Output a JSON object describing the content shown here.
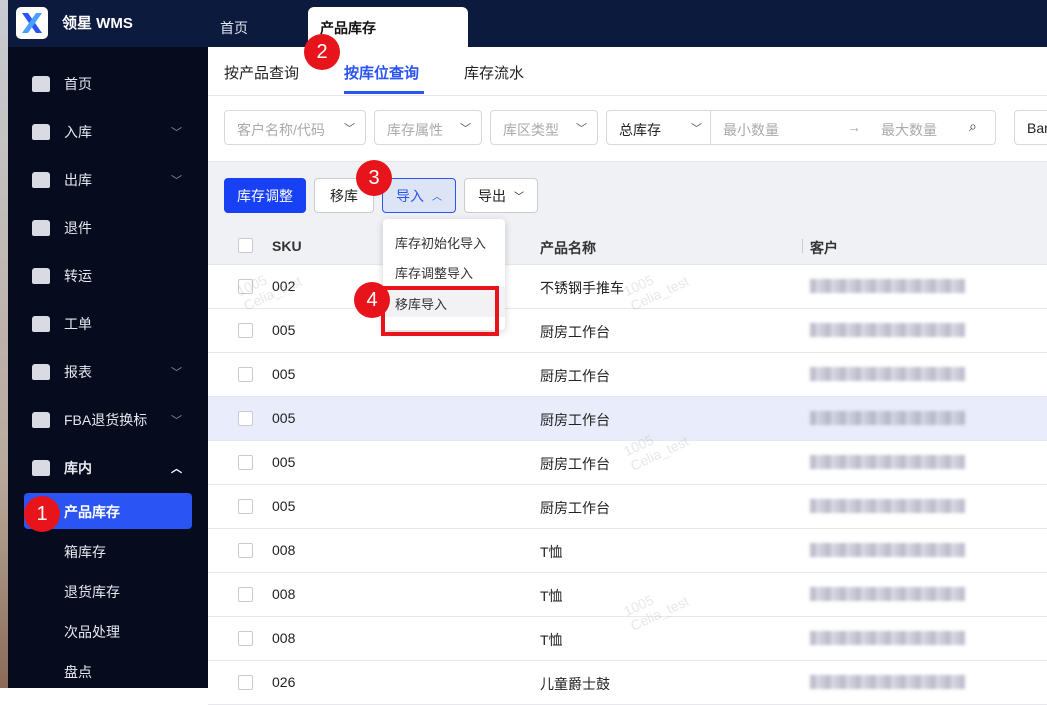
{
  "app": {
    "brand": "领星 WMS"
  },
  "top_tabs": [
    "首页",
    "产品库存"
  ],
  "sidebar": {
    "items": [
      {
        "label": "首页",
        "chevron": false
      },
      {
        "label": "入库",
        "chevron": "down"
      },
      {
        "label": "出库",
        "chevron": "down"
      },
      {
        "label": "退件",
        "chevron": false
      },
      {
        "label": "转运",
        "chevron": false
      },
      {
        "label": "工单",
        "chevron": false
      },
      {
        "label": "报表",
        "chevron": "down"
      },
      {
        "label": "FBA退货换标",
        "chevron": "down"
      },
      {
        "label": "库内",
        "chevron": "up"
      }
    ],
    "sub_items": [
      "产品库存",
      "箱库存",
      "退货库存",
      "次品处理",
      "盘点"
    ]
  },
  "sub_tabs": [
    "按产品查询",
    "按库位查询",
    "库存流水"
  ],
  "filters": {
    "customer": "客户名称/代码",
    "attr": "库存属性",
    "zone": "库区类型",
    "stock_type": "总库存",
    "min": "最小数量",
    "max": "最大数量",
    "extra": "Bar"
  },
  "toolbar": {
    "adjust": "库存调整",
    "move": "移库",
    "import": "导入",
    "export": "导出"
  },
  "import_menu": [
    "库存初始化导入",
    "库存调整导入",
    "移库导入"
  ],
  "table": {
    "headers": [
      "SKU",
      "产品名称",
      "客户"
    ],
    "rows": [
      [
        "002",
        "不锈钢手推车"
      ],
      [
        "005",
        "厨房工作台"
      ],
      [
        "005",
        "厨房工作台"
      ],
      [
        "005",
        "厨房工作台"
      ],
      [
        "005",
        "厨房工作台"
      ],
      [
        "005",
        "厨房工作台"
      ],
      [
        "008",
        "T恤"
      ],
      [
        "008",
        "T恤"
      ],
      [
        "008",
        "T恤"
      ],
      [
        "026",
        "儿童爵士鼓"
      ]
    ]
  },
  "badges": [
    "1",
    "2",
    "3",
    "4"
  ],
  "watermark": [
    "1005",
    "Celia_test"
  ],
  "colors": {
    "primary": "#2b54f5",
    "badge": "#e8141b",
    "topbar": "#0b1a3d",
    "sidebar": "#060b1e"
  }
}
